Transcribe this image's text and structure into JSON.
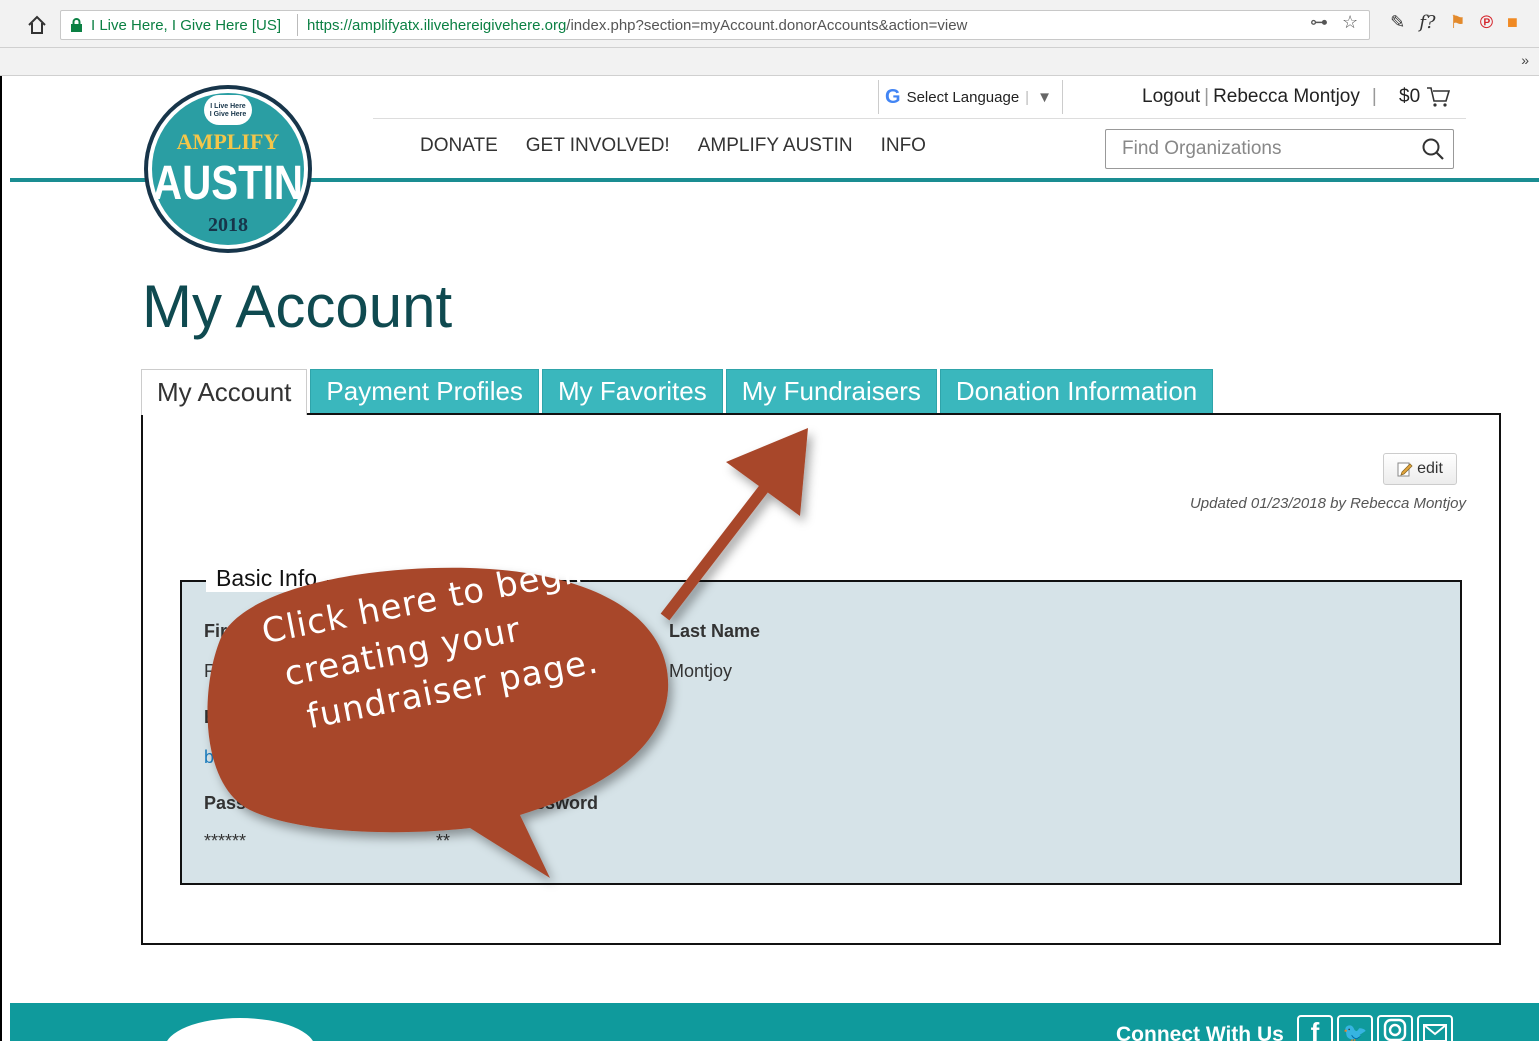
{
  "browser": {
    "site_name": "I Live Here, I Give Here [US]",
    "url_host": "https://amplifyatx.ilivehereigivehere.org",
    "url_path": "/index.php?section=myAccount.donorAccounts&action=view",
    "overflow": "»"
  },
  "header": {
    "logo": {
      "badge": "I Live Here I Give Here",
      "word1": "AMPLIFY",
      "word2": "AUSTIN",
      "year": "2018"
    },
    "language": {
      "label": "Select Language",
      "caret": "▼",
      "g": "G"
    },
    "account": {
      "logout": "Logout",
      "user": "Rebecca Montjoy"
    },
    "cart": {
      "amount": "$0"
    },
    "nav": [
      "DONATE",
      "GET INVOLVED!",
      "AMPLIFY AUSTIN",
      "INFO"
    ],
    "search": {
      "placeholder": "Find Organizations"
    }
  },
  "page": {
    "title": "My Account",
    "tabs": [
      {
        "label": "My Account",
        "active": true
      },
      {
        "label": "Payment Profiles",
        "active": false
      },
      {
        "label": "My Favorites",
        "active": false
      },
      {
        "label": "My Fundraisers",
        "active": false
      },
      {
        "label": "Donation Information",
        "active": false
      }
    ],
    "edit_label": "edit",
    "updated": "Updated 01/23/2018 by Rebecca Montjoy",
    "basic_info": {
      "legend": "Basic Info",
      "first_name_label": "First Na",
      "first_name_value": "Re",
      "last_name_label": "Last Name",
      "last_name_value": "Montjoy",
      "email_label": "E",
      "email_value": "be",
      "password_label": "Passwo",
      "password_value": "******",
      "confirm_password_label": "ssword",
      "confirm_password_value": "**"
    }
  },
  "callout": {
    "text_line1": "Click here to begin",
    "text_line2": "creating your",
    "text_line3": "fundraiser page.",
    "color": "#a8472c"
  },
  "footer": {
    "connect": "Connect With Us",
    "color": "#0f9a9c"
  },
  "colors": {
    "teal": "#1a8d92",
    "tab_teal": "#3ab7bd",
    "title": "#0f4a50",
    "fieldset_bg": "#d6e3e8"
  }
}
